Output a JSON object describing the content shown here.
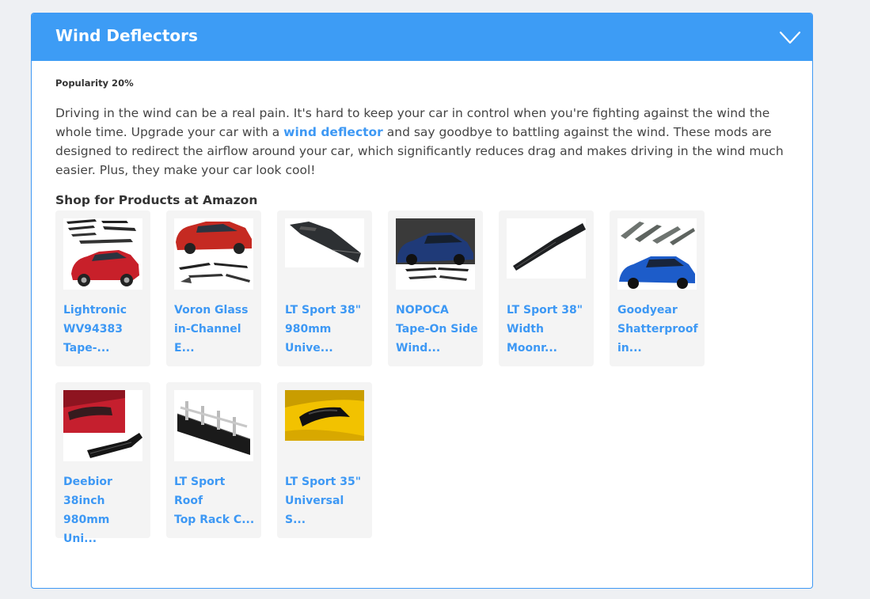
{
  "section": {
    "title": "Wind Deflectors",
    "popularity": "Popularity 20%",
    "description": {
      "before_link": "Driving in the wind can be a real pain. It's hard to keep your car in control when you're fighting against the wind the whole time. Upgrade your car with a ",
      "link_text": "wind deflector",
      "after_link": " and say goodbye to battling against the wind. These mods are designed to redirect the airflow around your car, which significantly reduces drag and makes driving in the wind much easier. Plus, they make your car look cool!"
    },
    "shop_heading": "Shop for Products at Amazon"
  },
  "products": [
    {
      "name": "Lightronic\nWV94383\nTape-...",
      "image": "red-suv-with-window-visors"
    },
    {
      "name": "Voron Glass\nin-Channel\nE...",
      "image": "red-suv-with-in-channel-visors"
    },
    {
      "name": "LT Sport 38\"\n980mm\nUnive...",
      "image": "sunroof-deflector"
    },
    {
      "name": "NOPOCA\nTape-On Side\nWind...",
      "image": "blue-suv-with-side-visors"
    },
    {
      "name": "LT Sport 38\"\nWidth\nMoonr...",
      "image": "moonroof-deflector"
    },
    {
      "name": "Goodyear\nShatterproof\nin...",
      "image": "blue-suv-with-visors"
    },
    {
      "name": "Deebior\n38inch\n980mm Uni...",
      "image": "red-roof-with-sunroof-deflector"
    },
    {
      "name": "LT Sport Roof\nTop Rack C...",
      "image": "roof-rack-fairing"
    },
    {
      "name": "LT Sport 35\"\nUniversal S...",
      "image": "yellow-car-sunroof-deflector"
    }
  ],
  "colors": {
    "accent": "#3d9cf5",
    "link": "#3d98f4",
    "card_bg": "#f4f4f4",
    "page_bg": "#eef0f3"
  }
}
